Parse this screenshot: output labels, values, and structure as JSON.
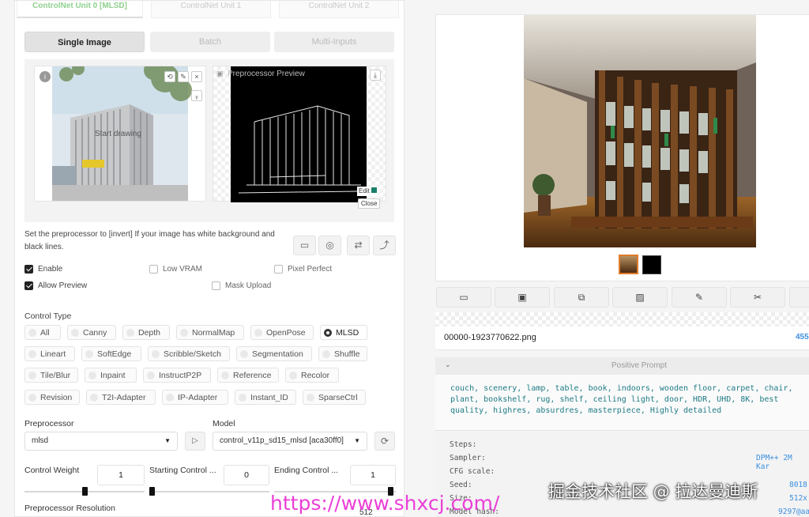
{
  "unit_tabs": [
    "ControlNet Unit 0 [MLSD]",
    "ControlNet Unit 1",
    "ControlNet Unit 2"
  ],
  "input_mode_tabs": [
    "Single Image",
    "Batch",
    "Multi-Inputs"
  ],
  "image_panel": {
    "start_drawing": "Start drawing",
    "preview_label": "Preprocessor Preview",
    "edit_label": "Edit",
    "close_label": "Close"
  },
  "invert_hint": "Set the preprocessor to [invert] If your image has white background and black lines.",
  "checkboxes": {
    "enable": {
      "label": "Enable",
      "checked": true
    },
    "low_vram": {
      "label": "Low VRAM",
      "checked": false
    },
    "pixel_perfect": {
      "label": "Pixel Perfect",
      "checked": false
    },
    "allow_preview": {
      "label": "Allow Preview",
      "checked": true
    },
    "mask_upload": {
      "label": "Mask Upload",
      "checked": false
    }
  },
  "control_type": {
    "label": "Control Type",
    "selected": "MLSD",
    "rows": [
      [
        "All",
        "Canny",
        "Depth",
        "NormalMap",
        "OpenPose",
        "MLSD"
      ],
      [
        "Lineart",
        "SoftEdge",
        "Scribble/Sketch",
        "Segmentation",
        "Shuffle"
      ],
      [
        "Tile/Blur",
        "Inpaint",
        "InstructP2P",
        "Reference",
        "Recolor"
      ],
      [
        "Revision",
        "T2I-Adapter",
        "IP-Adapter",
        "Instant_ID",
        "SparseCtrl"
      ]
    ]
  },
  "preprocessor": {
    "label": "Preprocessor",
    "value": "mlsd"
  },
  "model": {
    "label": "Model",
    "value": "control_v11p_sd15_mlsd [aca30ff0]"
  },
  "sliders": {
    "control_weight": {
      "label": "Control Weight",
      "value": "1",
      "fraction": 1.0
    },
    "starting_step": {
      "label": "Starting Control ...",
      "value": "0",
      "fraction": 0.0
    },
    "ending_step": {
      "label": "Ending Control ...",
      "value": "1",
      "fraction": 1.0
    },
    "resolution": {
      "label": "Preprocessor Resolution",
      "value": "512"
    }
  },
  "output": {
    "filename": "00000-1923770622.png",
    "filename_right": "455",
    "positive_prompt_label": "Positive Prompt",
    "prompt_text": "couch, scenery, lamp, table, book, indoors, wooden floor, carpet, chair, plant, bookshelf, rug, shelf, ceiling light, door, HDR, UHD, 8K, best quality, highres, absurdres, masterpiece, Highly detailed",
    "params": [
      {
        "key": "Steps:",
        "value": ""
      },
      {
        "key": "Sampler:",
        "value": "DPM++ 2M Kar"
      },
      {
        "key": "CFG scale:",
        "value": ""
      },
      {
        "key": "Seed:",
        "value": "8018"
      },
      {
        "key": "Size:",
        "value": "512x"
      },
      {
        "key": "Model hash:",
        "value": "9297@aa"
      }
    ]
  },
  "toolbar_icons": [
    "folder-icon",
    "save-icon",
    "zip-icon",
    "image-icon",
    "brush-icon",
    "layers-icon"
  ],
  "watermark": {
    "url": "https://www.shxcj.com/",
    "cn": "掘金技术社区 @ 拉达曼迪斯"
  }
}
